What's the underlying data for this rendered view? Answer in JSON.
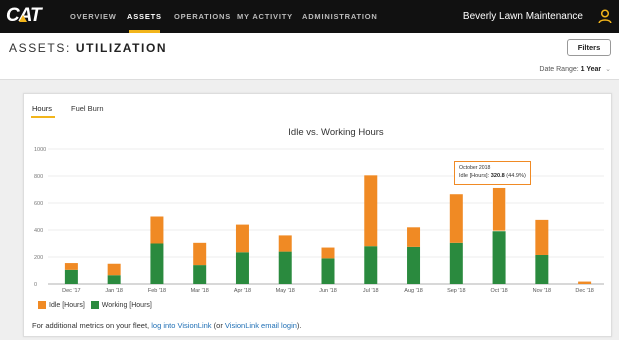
{
  "logo": {
    "text": "CAT"
  },
  "nav": {
    "items": [
      {
        "label": "OVERVIEW",
        "active": false
      },
      {
        "label": "ASSETS",
        "active": true
      },
      {
        "label": "OPERATIONS",
        "active": false
      },
      {
        "label": "MY ACTIVITY",
        "active": false
      },
      {
        "label": "ADMINISTRATION",
        "active": false
      }
    ],
    "account_name": "Beverly Lawn Maintenance",
    "user_icon": "user-icon"
  },
  "page": {
    "title_prefix": "ASSETS:",
    "title_main": "UTILIZATION",
    "filters_label": "Filters",
    "date_range_label": "Date Range:",
    "date_range_value": "1 Year"
  },
  "tabs": [
    {
      "label": "Hours",
      "active": true
    },
    {
      "label": "Fuel Burn",
      "active": false
    }
  ],
  "colors": {
    "idle": "#f08a24",
    "working": "#2a8a3e",
    "accent": "#f2b51b",
    "link": "#1f6fb5"
  },
  "chart_data": {
    "type": "bar",
    "stacked": true,
    "title": "Idle vs. Working Hours",
    "categories": [
      "Dec '17",
      "Jan '18",
      "Feb '18",
      "Mar '18",
      "Apr '18",
      "May '18",
      "Jun '18",
      "Jul '18",
      "Aug '18",
      "Sep '18",
      "Oct '18",
      "Nov '18",
      "Dec '18"
    ],
    "series": [
      {
        "name": "Working [Hours]",
        "color": "#2a8a3e",
        "values": [
          105,
          65,
          300,
          140,
          235,
          240,
          190,
          280,
          275,
          305,
          393,
          215,
          0
        ]
      },
      {
        "name": "Idle [Hours]",
        "color": "#f08a24",
        "values": [
          50,
          85,
          200,
          165,
          205,
          120,
          80,
          525,
          145,
          360,
          320.8,
          260,
          18
        ]
      }
    ],
    "ylim": [
      0,
      1000
    ],
    "yticks": [
      "0",
      "200",
      "400",
      "600",
      "800",
      "1000"
    ],
    "grid": true,
    "legend_placement": "bottom-left"
  },
  "tooltip": {
    "title": "October 2018",
    "label": "Idle [Hours]:",
    "value": "320.8",
    "pct": "(44.9%)"
  },
  "footer": {
    "prefix": "For additional metrics on your fleet,",
    "link1": "log into VisionLink",
    "mid": "(or",
    "link2": "VisionLink email login",
    "suffix": ")."
  }
}
